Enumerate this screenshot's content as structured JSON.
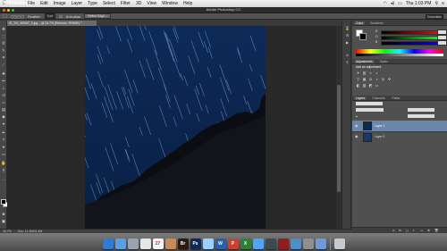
{
  "menubar": {
    "apple": "",
    "items": [
      "Photoshop",
      "File",
      "Edit",
      "Image",
      "Layer",
      "Type",
      "Select",
      "Filter",
      "3D",
      "View",
      "Window",
      "Help"
    ],
    "clock": "Thu 1:03 PM"
  },
  "titlebar": {
    "title": "Adobe Photoshop CC"
  },
  "optionsbar": {
    "feather_label": "Feather:",
    "feather_value": "0 px",
    "antialias_label": "Anti-alias",
    "refine_edge": "Refine Edge...",
    "workspace": "Essentials"
  },
  "document": {
    "tab_title": "IS_101_MGMT_0.jpg ...@ 34.7% (Remove, RGB/8*) *"
  },
  "panels": {
    "color_tabs": [
      "Color",
      "Swatches"
    ],
    "adjust_tabs": [
      "Adjustments",
      "Styles"
    ],
    "adjust_title": "Add an adjustment",
    "layers_tabs": [
      "Layers",
      "Channels",
      "Paths"
    ],
    "layers": [
      {
        "name": "Layer 1",
        "selected": true
      },
      {
        "name": "Layer 0",
        "selected": false
      }
    ]
  },
  "status": {
    "zoom": "33.7%",
    "doc": "Doc: 11.4M/11.4M"
  },
  "dock": {
    "apps": [
      {
        "icon": "finder-icon",
        "label": "",
        "bg": "#2f7bd6"
      },
      {
        "icon": "safari-icon",
        "label": "",
        "bg": "#5aa0e0"
      },
      {
        "icon": "rocket-icon",
        "label": "",
        "bg": "#9aa4b1"
      },
      {
        "icon": "chrome-icon",
        "label": "",
        "bg": "#e6e6e6"
      },
      {
        "icon": "calendar-icon",
        "label": "27",
        "bg": "#f4f4f4"
      },
      {
        "icon": "photos-icon",
        "label": "",
        "bg": "#c88a56"
      },
      {
        "icon": "bridge-icon",
        "label": "Br",
        "bg": "#2b1b12"
      },
      {
        "icon": "photoshop-icon",
        "label": "Ps",
        "bg": "#0c2a55"
      },
      {
        "icon": "finder-window-icon",
        "label": "",
        "bg": "#9ad0ff"
      },
      {
        "icon": "word-icon",
        "label": "W",
        "bg": "#2a5fae"
      },
      {
        "icon": "powerpoint-icon",
        "label": "P",
        "bg": "#c7432f"
      },
      {
        "icon": "excel-icon",
        "label": "X",
        "bg": "#2f7e3a"
      },
      {
        "icon": "messages-icon",
        "label": "",
        "bg": "#4fa4f5"
      },
      {
        "icon": "facetime-icon",
        "label": "",
        "bg": "#3e4a52"
      },
      {
        "icon": "photo-booth-icon",
        "label": "",
        "bg": "#8f1d1d"
      },
      {
        "icon": "iphoto-icon",
        "label": "",
        "bg": "#4e8ec9"
      },
      {
        "icon": "sysprefs-icon",
        "label": "",
        "bg": "#8f8f8f"
      },
      {
        "icon": "downloads-icon",
        "label": "",
        "bg": "#6f9ad6"
      },
      {
        "icon": "trash-icon",
        "label": "",
        "bg": "#c6cbd1"
      }
    ]
  },
  "colors": {
    "accent": "#0b2b55",
    "canvas_bg": "#282828"
  }
}
